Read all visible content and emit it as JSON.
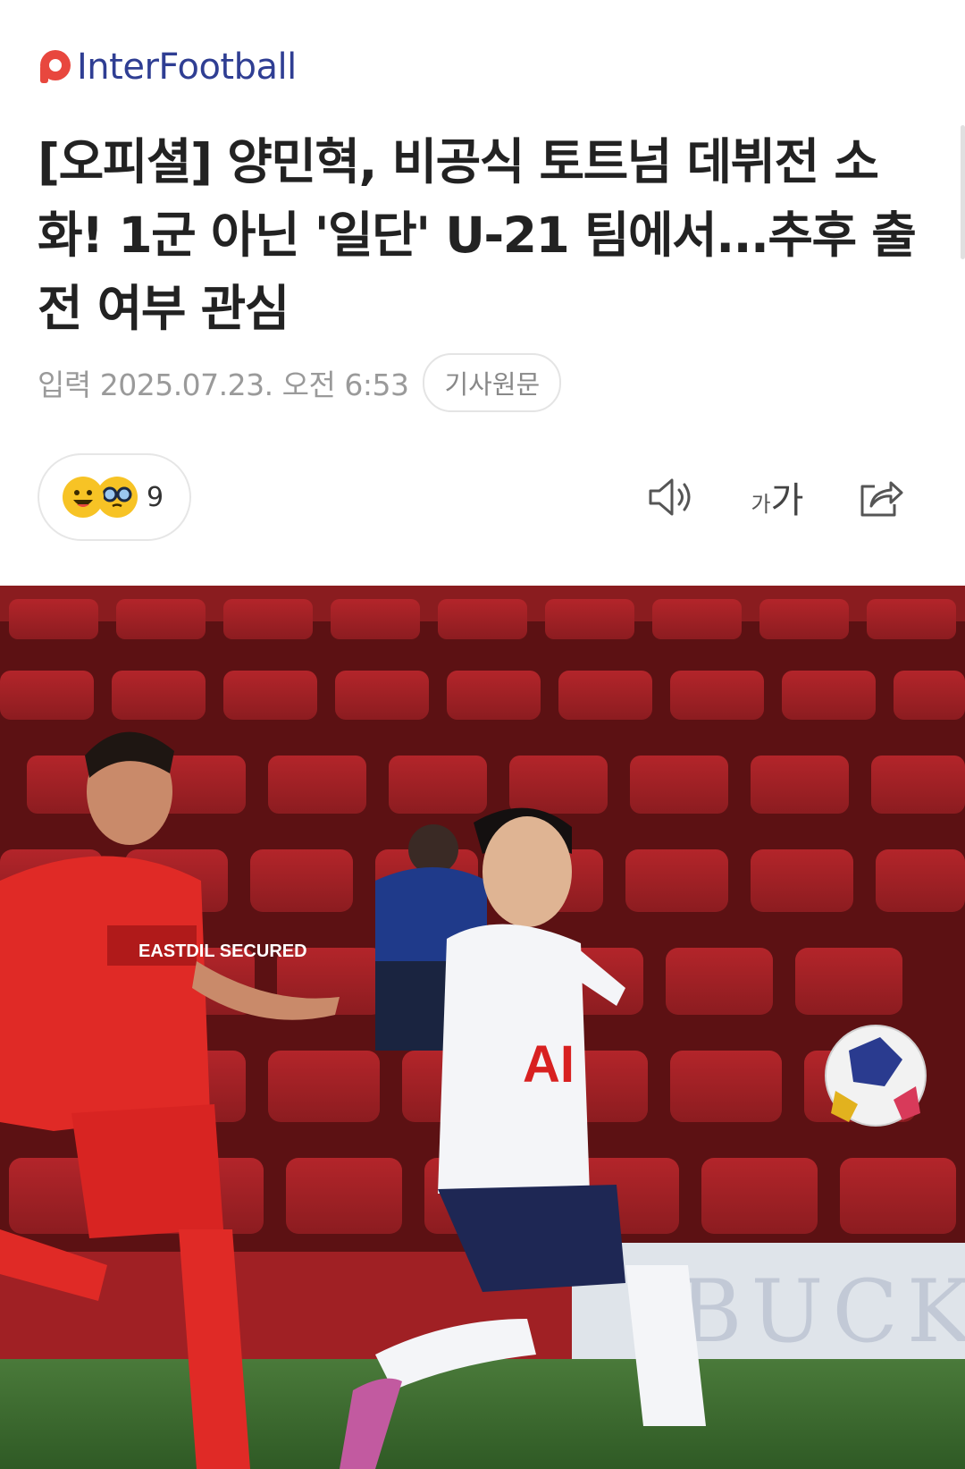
{
  "brand": {
    "name": "InterFootball",
    "color": "#2f3e93",
    "accent": "#e8473e"
  },
  "article": {
    "title": "[오피셜] 양민혁, 비공식 토트넘 데뷔전 소화! 1군 아닌 '일단' U-21 팀에서...추후 출전 여부 관심",
    "date": "입력 2025.07.23. 오전 6:53",
    "original_button": "기사원문"
  },
  "reactions": {
    "icons": [
      "smile-emoji",
      "glasses-emoji"
    ],
    "count": "9"
  },
  "tools": {
    "font_small": "가",
    "font_large": "가"
  },
  "photo": {
    "description_icons": [
      "stadium-seats",
      "player-red-kit",
      "player-white-kit",
      "football"
    ],
    "shirt_sponsor": "EASTDIL SECURED",
    "shirt_text": "AI",
    "board_text": "BUCK"
  }
}
